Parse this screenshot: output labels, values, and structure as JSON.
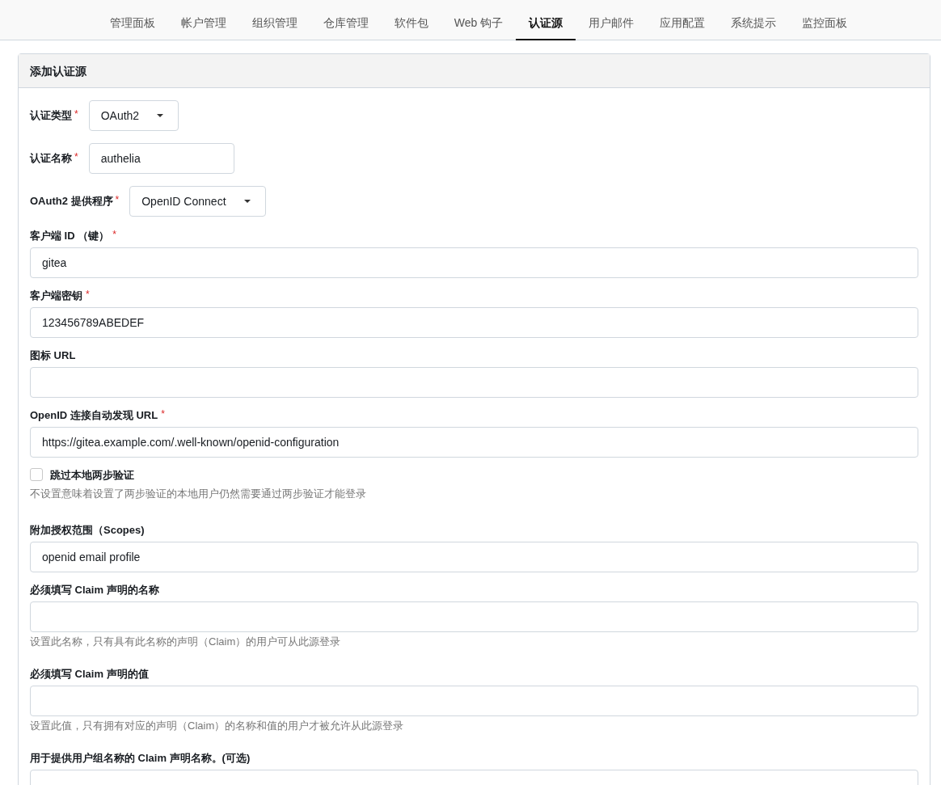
{
  "tabs": [
    {
      "label": "管理面板",
      "selected": false
    },
    {
      "label": "帐户管理",
      "selected": false
    },
    {
      "label": "组织管理",
      "selected": false
    },
    {
      "label": "仓库管理",
      "selected": false
    },
    {
      "label": "软件包",
      "selected": false
    },
    {
      "label": "Web 钩子",
      "selected": false
    },
    {
      "label": "认证源",
      "selected": true
    },
    {
      "label": "用户邮件",
      "selected": false
    },
    {
      "label": "应用配置",
      "selected": false
    },
    {
      "label": "系统提示",
      "selected": false
    },
    {
      "label": "监控面板",
      "selected": false
    }
  ],
  "card": {
    "title": "添加认证源",
    "fields": [
      {
        "kind": "select",
        "label": "认证类型",
        "required_mark": "*",
        "value": "OAuth2"
      },
      {
        "kind": "inline",
        "label": "认证名称",
        "required_mark": "*",
        "value": "authelia"
      },
      {
        "kind": "select",
        "label": "OAuth2 提供程序",
        "required_mark": "*",
        "value": "OpenID Connect"
      },
      {
        "kind": "text",
        "label": "客户端 ID （键）",
        "required_mark": "*",
        "value": "gitea"
      },
      {
        "kind": "text",
        "label": "客户端密钥",
        "required_mark": "*",
        "value": "123456789ABEDEF"
      },
      {
        "kind": "text",
        "label": "图标 URL"
      },
      {
        "kind": "text",
        "label": "OpenID 连接自动发现 URL",
        "required_mark": "*",
        "value": "https://gitea.example.com/.well-known/openid-configuration"
      },
      {
        "kind": "checkbox",
        "label": "跳过本地两步验证",
        "checked": false,
        "help": "不设置意味着设置了两步验证的本地用户仍然需要通过两步验证才能登录"
      },
      {
        "kind": "text",
        "label": "附加授权范围（Scopes)",
        "value": "openid email profile"
      },
      {
        "kind": "text",
        "label": "必须填写 Claim 声明的名称",
        "help": "设置此名称，只有具有此名称的声明（Claim）的用户可从此源登录"
      },
      {
        "kind": "text",
        "label": "必须填写 Claim 声明的值",
        "help": "设置此值，只有拥有对应的声明（Claim）的名称和值的用户才被允许从此源登录"
      },
      {
        "kind": "text",
        "label": "用于提供用户组名称的 Claim 声明名称。(可选)"
      }
    ]
  }
}
